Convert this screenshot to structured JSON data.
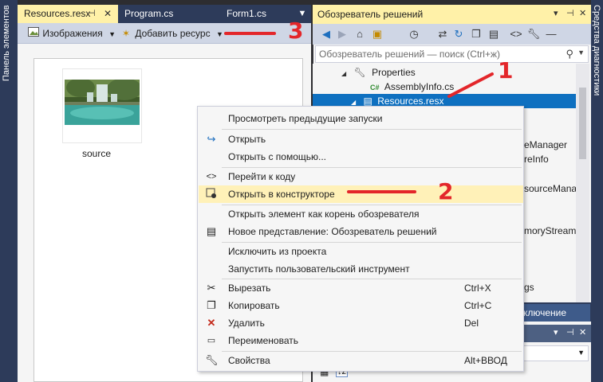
{
  "toolbox_strip": {
    "label": "Панель элементов"
  },
  "right_strip": {
    "label": "Средства диагностики"
  },
  "doc_tabs": [
    {
      "label": "Resources.resx",
      "active": true
    },
    {
      "label": "Program.cs",
      "active": false
    },
    {
      "label": "Form1.cs",
      "active": false
    }
  ],
  "res_toolbar": {
    "images_label": "Изображения",
    "add_resource_label": "Добавить ресурс"
  },
  "resource_item": {
    "caption": "source"
  },
  "solution_explorer": {
    "title": "Обозреватель решений",
    "search_placeholder": "Обозреватель решений — поиск (Ctrl+ж)",
    "tree": [
      {
        "label": "Properties"
      },
      {
        "label": "AssemblyInfo.cs"
      },
      {
        "label": "Resources.resx",
        "selected": true
      },
      {
        "label": "eManager"
      },
      {
        "label": "reInfo"
      },
      {
        "label": "sourceManag"
      },
      {
        "label": "moryStream"
      },
      {
        "label": "gs"
      }
    ],
    "bottom_tab": "Team Explorer — подключение",
    "bottom_tab_visible": "ключение"
  },
  "context_menu": {
    "items": [
      {
        "label": "Просмотреть предыдущие запуски",
        "shortcut": "",
        "icon": ""
      },
      {
        "label": "Открыть",
        "shortcut": "",
        "icon": "open-arrow-icon"
      },
      {
        "label": "Открыть с помощью...",
        "shortcut": "",
        "icon": ""
      },
      {
        "label": "Перейти к коду",
        "shortcut": "",
        "icon": "code-icon"
      },
      {
        "label": "Открыть в конструкторе",
        "shortcut": "",
        "icon": "designer-icon",
        "highlighted": true
      },
      {
        "label": "Открыть элемент как корень обозревателя",
        "shortcut": "",
        "icon": ""
      },
      {
        "label": "Новое представление: Обозреватель решений",
        "shortcut": "",
        "icon": "new-view-icon"
      },
      {
        "label": "Исключить из проекта",
        "shortcut": "",
        "icon": ""
      },
      {
        "label": "Запустить пользовательский инструмент",
        "shortcut": "",
        "icon": ""
      },
      {
        "label": "Вырезать",
        "shortcut": "Ctrl+X",
        "icon": "scissors-icon"
      },
      {
        "label": "Копировать",
        "shortcut": "Ctrl+C",
        "icon": "copy-icon"
      },
      {
        "label": "Удалить",
        "shortcut": "Del",
        "icon": "delete-x-icon"
      },
      {
        "label": "Переименовать",
        "shortcut": "",
        "icon": "rename-icon"
      },
      {
        "label": "Свойства",
        "shortcut": "Alt+ВВОД",
        "icon": "wrench-icon"
      }
    ]
  },
  "annotations": {
    "n1": "1",
    "n2": "2",
    "n3": "3"
  },
  "colors": {
    "annotation_red": "#e3262a",
    "selection_blue": "#0e70c0",
    "active_tab_yellow": "#fff1a8"
  }
}
